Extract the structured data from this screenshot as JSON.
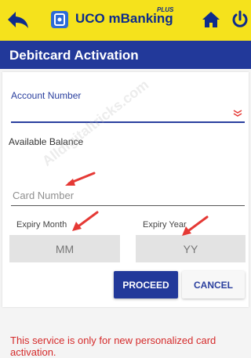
{
  "app": {
    "name": "UCO mBanking",
    "badge": "PLUS"
  },
  "header": {
    "title": "Debitcard Activation"
  },
  "form": {
    "account_label": "Account Number",
    "balance_label": "Available Balance",
    "card_placeholder": "Card Number",
    "expiry_month_label": "Expiry Month",
    "expiry_year_label": "Expiry Year",
    "month_placeholder": "MM",
    "year_placeholder": "YY"
  },
  "actions": {
    "proceed": "PROCEED",
    "cancel": "CANCEL"
  },
  "notice": "This service is only for new personalized card activation.",
  "watermark": "Alldigitaltricks.com",
  "icons": [
    "back-arrow-icon",
    "uco-logo-icon",
    "home-icon",
    "power-icon",
    "chevron-down-icon"
  ],
  "colors": {
    "topbar": "#f5e21c",
    "primary": "#22399a",
    "alert": "#d52b2b",
    "annotation": "#e53935"
  }
}
